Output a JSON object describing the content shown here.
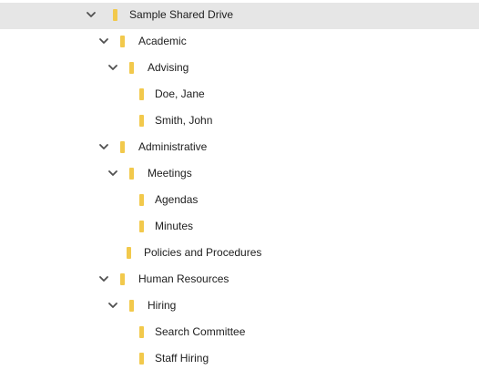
{
  "colors": {
    "folder": "#f2c94c",
    "selected_bg": "#e6e6e6",
    "chevron": "#505050",
    "text": "#202020"
  },
  "icons": {
    "expand": "chevron-down-icon",
    "folder": "folder-icon"
  },
  "tree": [
    {
      "label": "Sample Shared Drive",
      "depth": 0,
      "expanded": true,
      "selected": true
    },
    {
      "label": "Academic",
      "depth": 1,
      "expanded": true,
      "selected": false
    },
    {
      "label": "Advising",
      "depth": 2,
      "expanded": true,
      "selected": false
    },
    {
      "label": "Doe, Jane",
      "depth": 3,
      "expanded": false,
      "selected": false
    },
    {
      "label": "Smith, John",
      "depth": 3,
      "expanded": false,
      "selected": false
    },
    {
      "label": "Administrative",
      "depth": 1,
      "expanded": true,
      "selected": false
    },
    {
      "label": "Meetings",
      "depth": 2,
      "expanded": true,
      "selected": false
    },
    {
      "label": "Agendas",
      "depth": 3,
      "expanded": false,
      "selected": false
    },
    {
      "label": "Minutes",
      "depth": 3,
      "expanded": false,
      "selected": false
    },
    {
      "label": "Policies and Procedures",
      "depth": 2,
      "expanded": false,
      "selected": false
    },
    {
      "label": "Human Resources",
      "depth": 1,
      "expanded": true,
      "selected": false
    },
    {
      "label": "Hiring",
      "depth": 2,
      "expanded": true,
      "selected": false
    },
    {
      "label": "Search Committee",
      "depth": 3,
      "expanded": false,
      "selected": false
    },
    {
      "label": "Staff Hiring",
      "depth": 3,
      "expanded": false,
      "selected": false
    }
  ]
}
